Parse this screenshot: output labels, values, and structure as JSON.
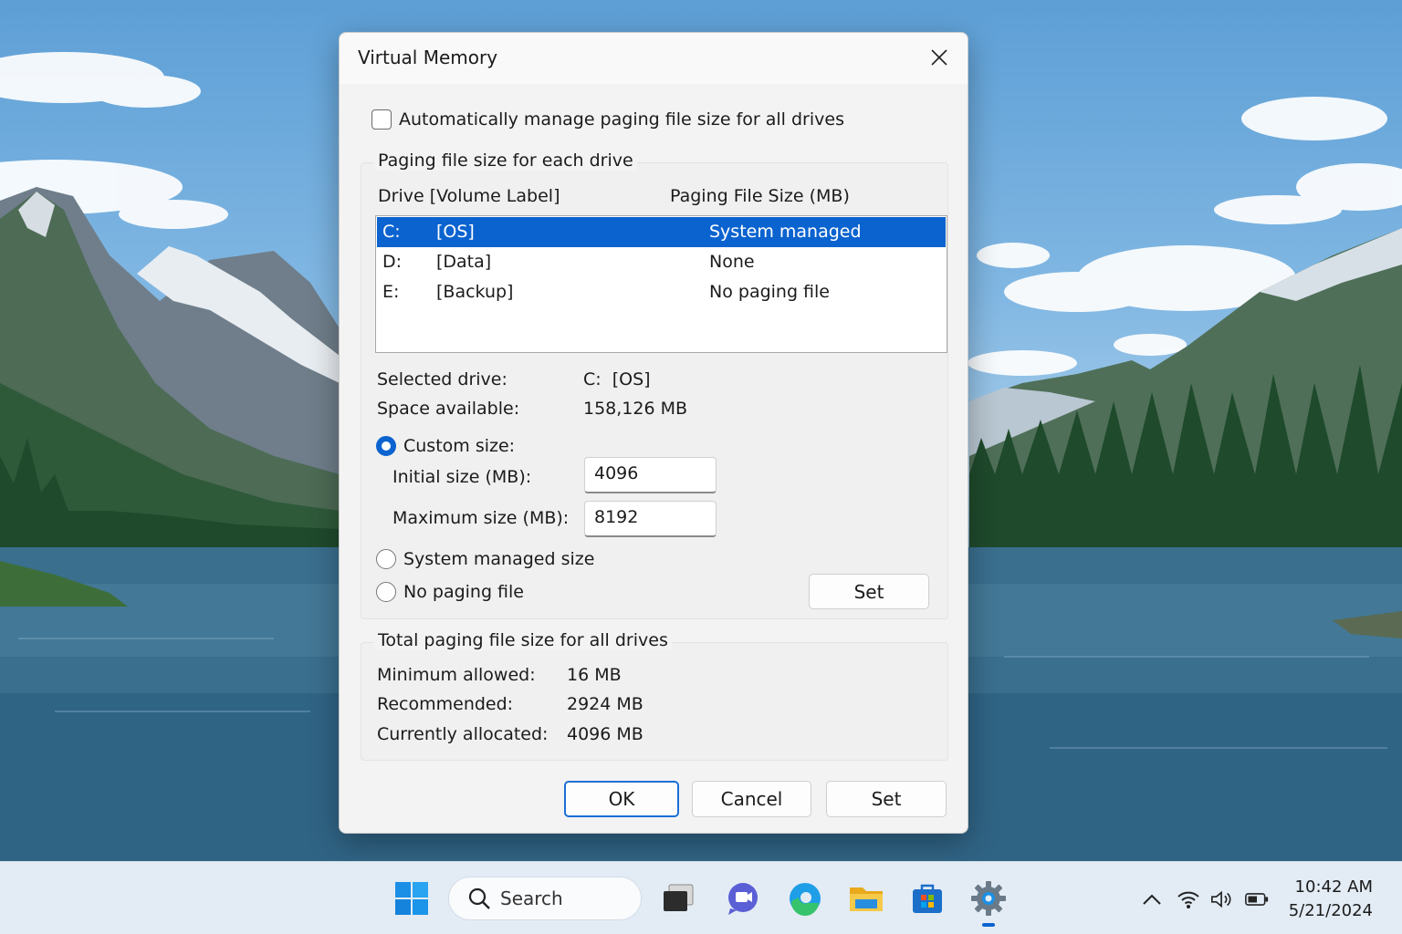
{
  "dialog": {
    "title": "Virtual Memory",
    "auto_manage_label": "Automatically manage paging file size for all drives",
    "auto_manage_checked": false,
    "paging_group_label": "Paging file size for each drive",
    "columns": {
      "drive": "Drive  [Volume Label]",
      "size": "Paging File Size (MB)"
    },
    "drives": [
      {
        "letter": "C:",
        "label": "[OS]",
        "size": "System managed",
        "selected": true
      },
      {
        "letter": "D:",
        "label": "[Data]",
        "size": "None",
        "selected": false
      },
      {
        "letter": "E:",
        "label": "[Backup]",
        "size": "No paging file",
        "selected": false
      }
    ],
    "selected_drive_label": "Selected drive:",
    "selected_drive_value": "C:  [OS]",
    "space_available_label": "Space available:",
    "space_available_value": "158,126 MB",
    "custom_size_label": "Custom size:",
    "initial_size_label": "Initial size (MB):",
    "initial_size_value": "4096",
    "maximum_size_label": "Maximum size (MB):",
    "maximum_size_value": "8192",
    "system_managed_label": "System managed size",
    "no_paging_label": "No paging file",
    "selected_option": "custom",
    "set_label": "Set",
    "total_group_label": "Total paging file size for all drives",
    "minimum_allowed_label": "Minimum allowed:",
    "minimum_allowed_value": "16 MB",
    "recommended_label": "Recommended:",
    "recommended_value": "2924 MB",
    "currently_allocated_label": "Currently allocated:",
    "currently_allocated_value": "4096 MB",
    "ok_label": "OK",
    "cancel_label": "Cancel",
    "set_bottom_label": "Set"
  },
  "taskbar": {
    "search_label": "Search",
    "icons": [
      "windows-start-icon",
      "task-view-icon",
      "chat-icon",
      "edge-icon",
      "file-explorer-icon",
      "store-icon",
      "settings-icon"
    ],
    "tray_icons": [
      "chevron-up-icon",
      "wifi-icon",
      "volume-icon",
      "battery-icon"
    ],
    "time": "10:42 AM",
    "date": "5/21/2024"
  },
  "colors": {
    "accent": "#0b63cf",
    "dialog_bg": "#f3f3f3",
    "taskbar_bg": "#e3ecf5"
  }
}
